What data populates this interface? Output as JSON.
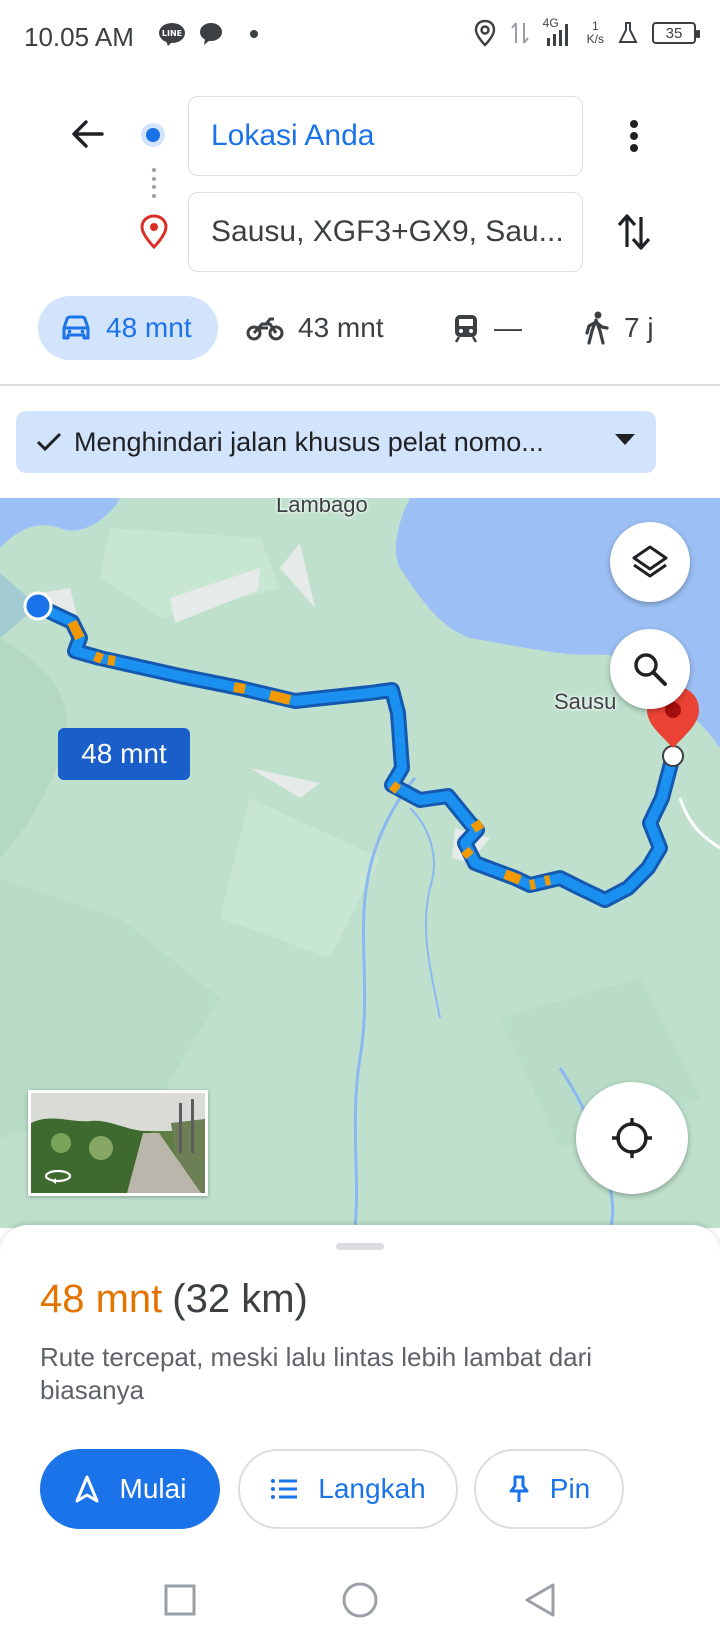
{
  "status_bar": {
    "time": "10.05 AM",
    "network": "4G",
    "speed_value": "1",
    "speed_unit": "K/s",
    "battery": "35"
  },
  "directions": {
    "origin": "Lokasi Anda",
    "destination": "Sausu, XGF3+GX9, Sau..."
  },
  "modes": [
    {
      "name": "car",
      "label": "48 mnt",
      "active": true
    },
    {
      "name": "motorcycle",
      "label": "43 mnt",
      "active": false
    },
    {
      "name": "transit",
      "label": "—",
      "active": false
    },
    {
      "name": "walk",
      "label": "7 j",
      "active": false
    }
  ],
  "option_chip": {
    "label": "Menghindari jalan khusus pelat nomo..."
  },
  "map": {
    "place_labels": [
      "Lambago",
      "Sausu"
    ],
    "route_badge": "48 mnt",
    "colors": {
      "land": "#bfe0cd",
      "water": "#9cc0f5",
      "route": "#1a91f0",
      "route_outline": "#1558b0",
      "traffic_slow": "#f29900",
      "destination_pin": "#ea4335"
    }
  },
  "sheet": {
    "duration": "48 mnt",
    "distance": "(32 km)",
    "description": "Rute tercepat, meski lalu lintas lebih lambat dari biasanya",
    "buttons": {
      "start": "Mulai",
      "steps": "Langkah",
      "pin": "Pin"
    }
  },
  "colors": {
    "accent": "#1a73e8",
    "accent_light": "#d2e3fc",
    "duration_orange": "#e37400"
  }
}
